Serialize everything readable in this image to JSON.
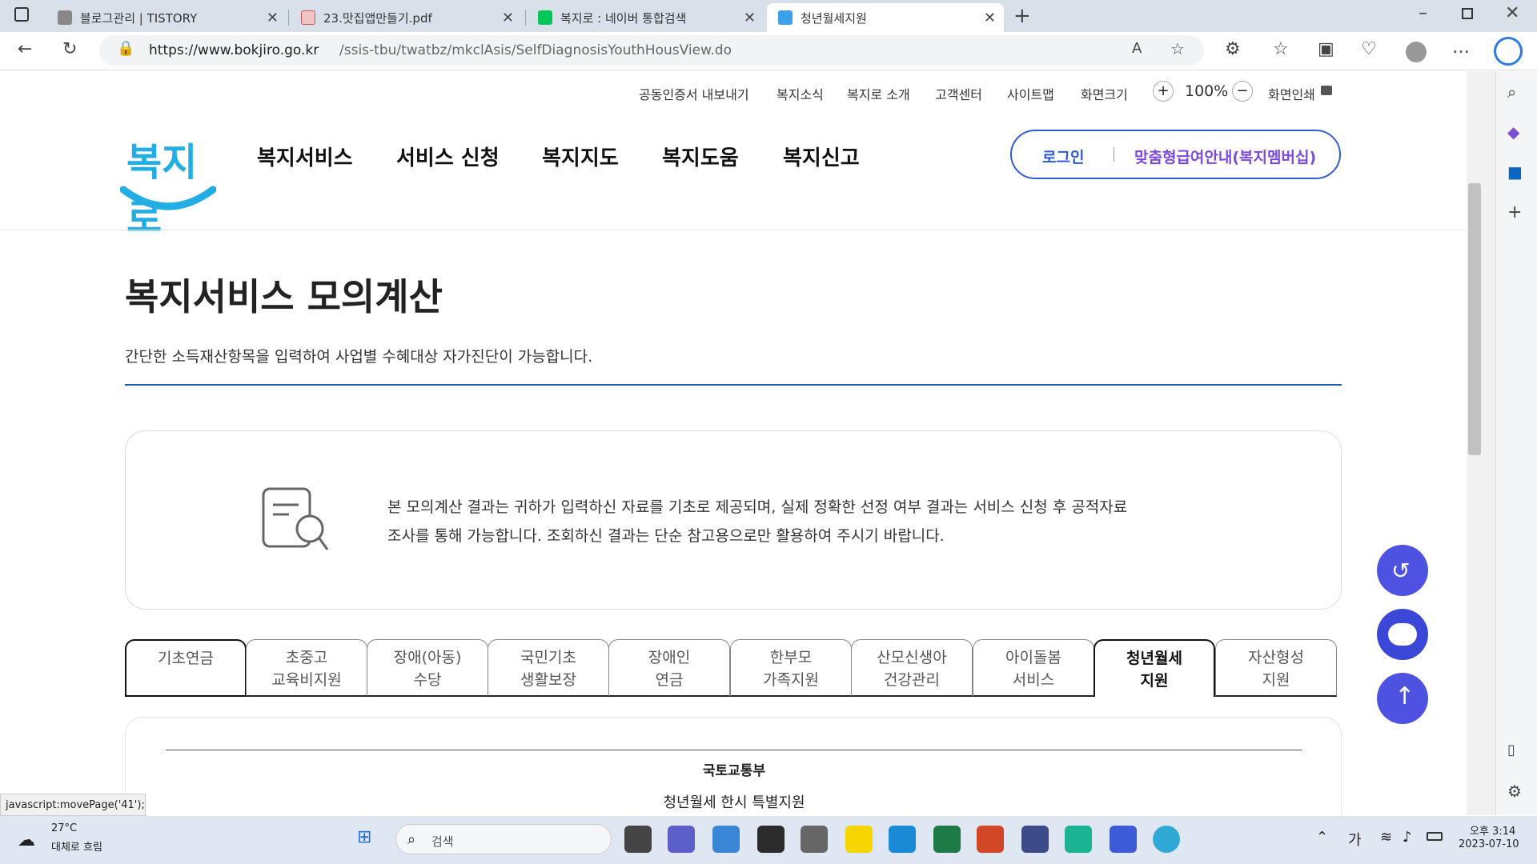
{
  "browser": {
    "tabs": [
      {
        "label": "블로그관리 | TISTORY"
      },
      {
        "label": "23.맛집앱만들기.pdf"
      },
      {
        "label": "복지로 : 네이버 통합검색"
      },
      {
        "label": "청년월세지원"
      }
    ],
    "url_host": "https://www.bokjiro.go.kr",
    "url_path": "/ssis-tbu/twatbz/mkclAsis/SelfDiagnosisYouthHousView.do",
    "status_text": "javascript:movePage('41');"
  },
  "site": {
    "logo_text": "복지로",
    "utility": [
      "공동인증서 내보내기",
      "복지소식",
      "복지로 소개",
      "고객센터",
      "사이트맵",
      "화면크기"
    ],
    "zoom": "100%",
    "print": "화면인쇄",
    "nav": [
      "복지서비스",
      "서비스 신청",
      "복지지도",
      "복지도움",
      "복지신고"
    ],
    "login": "로그인",
    "membership": "맞춤형급여안내(복지멤버십)"
  },
  "main": {
    "title": "복지서비스 모의계산",
    "description": "간단한 소득재산항목을 입력하여 사업별 수혜대상 자가진단이 가능합니다.",
    "notice_line1": "본 모의계산 결과는 귀하가 입력하신 자료를 기초로 제공되며, 실제 정확한 선정 여부 결과는 서비스 신청 후 공적자료",
    "notice_line2": "조사를 통해 가능합니다. 조회하신 결과는 단순 참고용으로만 활용하여 주시기 바랍니다.",
    "service_tabs": [
      {
        "l1": "기초연금",
        "l2": ""
      },
      {
        "l1": "초중고",
        "l2": "교육비지원"
      },
      {
        "l1": "장애(아동)",
        "l2": "수당"
      },
      {
        "l1": "국민기초",
        "l2": "생활보장"
      },
      {
        "l1": "장애인",
        "l2": "연금"
      },
      {
        "l1": "한부모",
        "l2": "가족지원"
      },
      {
        "l1": "산모신생아",
        "l2": "건강관리"
      },
      {
        "l1": "아이돌봄",
        "l2": "서비스"
      },
      {
        "l1": "청년월세",
        "l2": "지원"
      },
      {
        "l1": "자산형성",
        "l2": "지원"
      }
    ],
    "active_tab": "청년월세",
    "ministry": "국토교통부",
    "program": "청년월세 한시 특별지원"
  },
  "taskbar": {
    "weather_temp": "27°C",
    "weather_desc": "대체로 흐림",
    "search": "검색",
    "ime": "가",
    "time": "오후 3:14",
    "date": "2023-07-10"
  },
  "colors": {
    "brand": "#2f5bd8",
    "fab": "#4e52e0",
    "divider": "#1a5fb4"
  }
}
